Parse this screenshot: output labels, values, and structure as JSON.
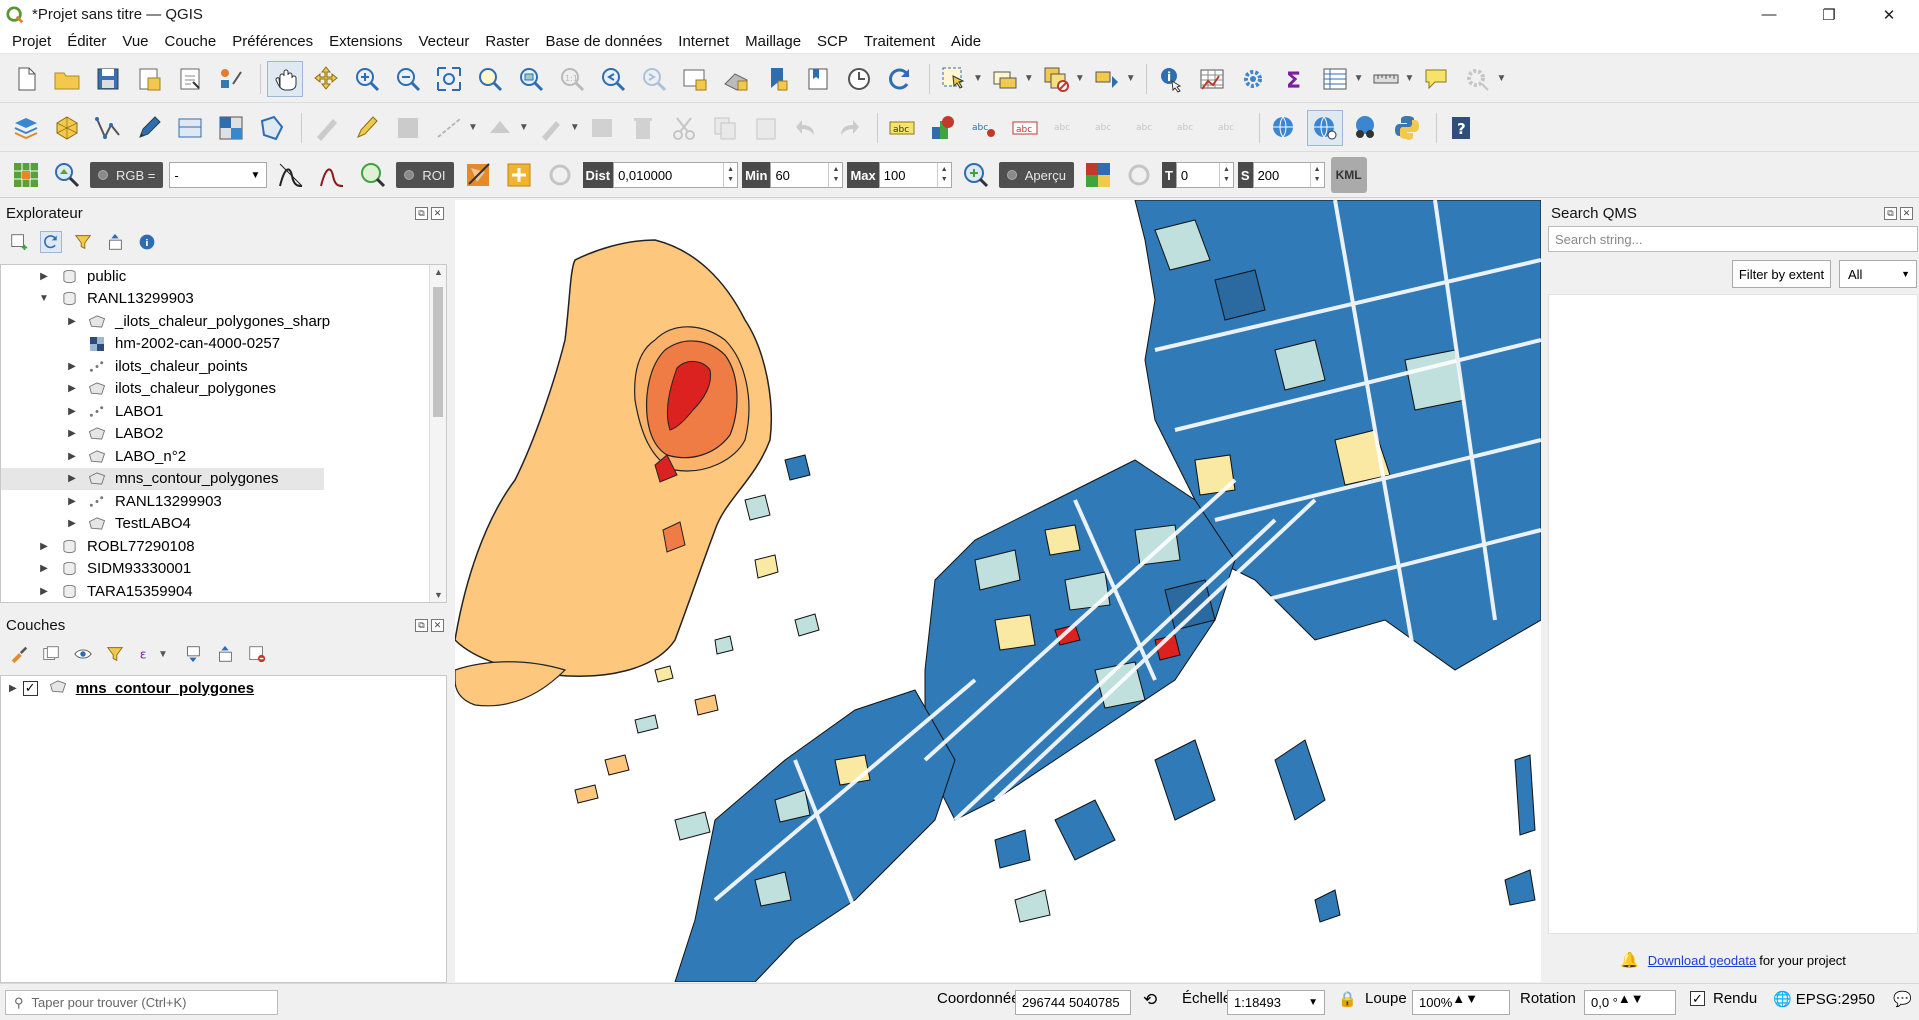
{
  "window": {
    "title": "*Projet sans titre — QGIS",
    "controls": [
      "—",
      "❐",
      "✕"
    ]
  },
  "menu": [
    "Projet",
    "Éditer",
    "Vue",
    "Couche",
    "Préférences",
    "Extensions",
    "Vecteur",
    "Raster",
    "Base de données",
    "Internet",
    "Maillage",
    "SCP",
    "Traitement",
    "Aide"
  ],
  "scp_toolbar": {
    "rgb_label": "RGB =",
    "rgb_value": "-",
    "roi_label": "ROI",
    "dist_label": "Dist",
    "dist_value": "0,010000",
    "min_label": "Min",
    "min_value": "60",
    "max_label": "Max",
    "max_value": "100",
    "apercu_label": "Aperçu",
    "t_label": "T",
    "t_value": "0",
    "s_label": "S",
    "s_value": "200",
    "kml_label": "KML"
  },
  "explorer": {
    "title": "Explorateur",
    "items": [
      {
        "label": "public",
        "level": 1,
        "type": "db",
        "expanded": false
      },
      {
        "label": "RANL13299903",
        "level": 1,
        "type": "db",
        "expanded": true
      },
      {
        "label": "_ilots_chaleur_polygones_sharp",
        "level": 2,
        "type": "polygon"
      },
      {
        "label": "hm-2002-can-4000-0257",
        "level": 2,
        "type": "raster"
      },
      {
        "label": "ilots_chaleur_points",
        "level": 2,
        "type": "points"
      },
      {
        "label": "ilots_chaleur_polygones",
        "level": 2,
        "type": "polygon"
      },
      {
        "label": "LABO1",
        "level": 2,
        "type": "points"
      },
      {
        "label": "LABO2",
        "level": 2,
        "type": "polygon"
      },
      {
        "label": "LABO_n°2",
        "level": 2,
        "type": "polygon"
      },
      {
        "label": "mns_contour_polygones",
        "level": 2,
        "type": "polygon",
        "selected": true
      },
      {
        "label": "RANL13299903",
        "level": 2,
        "type": "points"
      },
      {
        "label": "TestLABO4",
        "level": 2,
        "type": "polygon"
      },
      {
        "label": "ROBL77290108",
        "level": 1,
        "type": "db",
        "expanded": false
      },
      {
        "label": "SIDM93330001",
        "level": 1,
        "type": "db",
        "expanded": false
      },
      {
        "label": "TARA15359904",
        "level": 1,
        "type": "db",
        "expanded": false
      }
    ]
  },
  "layers": {
    "title": "Couches",
    "items": [
      {
        "label": "mns_contour_polygones",
        "checked": true
      }
    ]
  },
  "qms": {
    "title": "Search QMS",
    "placeholder": "Search string...",
    "filter_button": "Filter by extent",
    "filter_value": "All",
    "footer_link": "Download geodata",
    "footer_text": "for your project"
  },
  "status": {
    "locator_placeholder": "Taper pour trouver (Ctrl+K)",
    "coord_label": "Coordonnée",
    "coord_value": "296744  5040785",
    "scale_label": "Échelle",
    "scale_value": "1:18493",
    "loupe_label": "Loupe",
    "loupe_value": "100%",
    "rotation_label": "Rotation",
    "rotation_value": "0,0 °",
    "render_label": "Rendu",
    "crs_label": "EPSG:2950"
  },
  "colors": {
    "contour_low": "#fdc77e",
    "contour_mid": "#fbb26a",
    "contour_high": "#ef7b45",
    "contour_top": "#dc2121",
    "buildings": "#2f7ab7",
    "buildings_light": "#bfe0dc",
    "buildings_yellow": "#f9e9a3"
  }
}
